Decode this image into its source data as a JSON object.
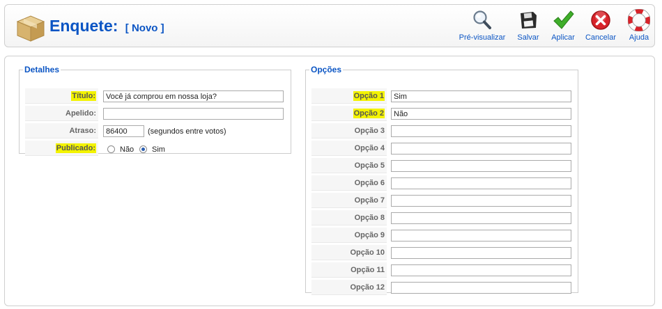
{
  "header": {
    "title": "Enquete:",
    "subtitle": "[ Novo ]"
  },
  "toolbar": {
    "buttons": [
      {
        "label": "Pré-visualizar",
        "icon": "magnifier-icon"
      },
      {
        "label": "Salvar",
        "icon": "floppy-disk-icon"
      },
      {
        "label": "Aplicar",
        "icon": "checkmark-icon"
      },
      {
        "label": "Cancelar",
        "icon": "cancel-icon"
      },
      {
        "label": "Ajuda",
        "icon": "lifebuoy-icon"
      }
    ]
  },
  "details": {
    "legend": "Detalhes",
    "title_label": "Título:",
    "title_value": "Você já comprou em nossa loja?",
    "alias_label": "Apelido:",
    "alias_value": "",
    "delay_label": "Atraso:",
    "delay_value": "86400",
    "delay_note": "(segundos entre votos)",
    "published_label": "Publicado:",
    "published_options": [
      "Não",
      "Sim"
    ],
    "published_selected": "Sim"
  },
  "options": {
    "legend": "Opções",
    "items": [
      {
        "label": "Opção 1",
        "value": "Sim"
      },
      {
        "label": "Opção 2",
        "value": "Não"
      },
      {
        "label": "Opção 3",
        "value": ""
      },
      {
        "label": "Opção 4",
        "value": ""
      },
      {
        "label": "Opção 5",
        "value": ""
      },
      {
        "label": "Opção 6",
        "value": ""
      },
      {
        "label": "Opção 7",
        "value": ""
      },
      {
        "label": "Opção 8",
        "value": ""
      },
      {
        "label": "Opção 9",
        "value": ""
      },
      {
        "label": "Opção 10",
        "value": ""
      },
      {
        "label": "Opção 11",
        "value": ""
      },
      {
        "label": "Opção 12",
        "value": ""
      }
    ]
  },
  "colors": {
    "accent": "#0b55c4",
    "highlight": "#f3f300"
  }
}
